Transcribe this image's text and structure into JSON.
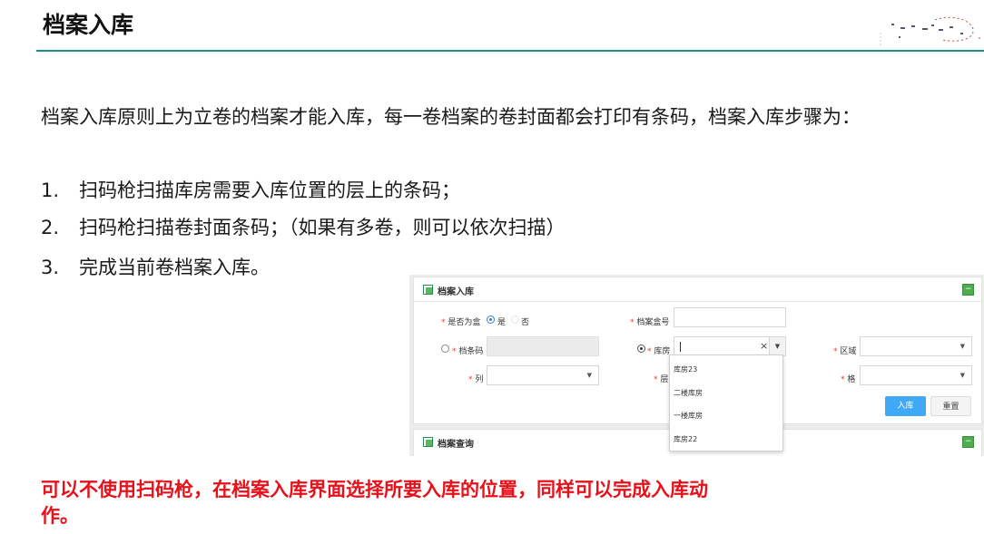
{
  "slide": {
    "title": "档案入库",
    "paragraph": "档案入库原则上为立卷的档案才能入库，每一卷档案的卷封面都会打印有条码，档案入库步骤为：",
    "steps": [
      {
        "num": "1.",
        "text": "扫码枪扫描库房需要入库位置的层上的条码；"
      },
      {
        "num": "2.",
        "text": "扫码枪扫描卷封面条码；（如果有多卷，则可以依次扫描）"
      },
      {
        "num": "3.",
        "text": "完成当前卷档案入库。"
      }
    ],
    "note": "可以不使用扫码枪，在档案入库界面选择所要入库的位置，同样可以完成入库动作。",
    "accent_color": "#1b8f8a",
    "note_color": "#e8101a"
  },
  "app": {
    "panel_entry": {
      "title": "档案入库",
      "collapse_icon": "minus-icon",
      "fields": {
        "is_box": {
          "label": "是否为盒",
          "options": [
            "是",
            "否"
          ],
          "selected": "是"
        },
        "box_no": {
          "label": "档案盒号",
          "value": ""
        },
        "barcode": {
          "label": "档条码",
          "value": ""
        },
        "storeroom": {
          "label": "库房",
          "value": ""
        },
        "area": {
          "label": "区域",
          "value": ""
        },
        "column": {
          "label": "列",
          "value": ""
        },
        "layer": {
          "label": "层",
          "value": ""
        },
        "cell": {
          "label": "格",
          "value": ""
        }
      },
      "storeroom_options": [
        "库房23",
        "二楼库房",
        "一楼库房",
        "库房22"
      ],
      "buttons": {
        "submit": "入库",
        "reset": "重置"
      }
    },
    "panel_query": {
      "title": "档案查询",
      "collapse_icon": "minus-icon"
    },
    "primary_color": "#3fa9f5"
  }
}
